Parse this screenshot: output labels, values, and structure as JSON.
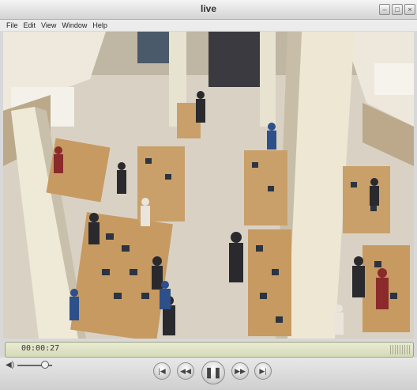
{
  "window": {
    "title": "live"
  },
  "menu": [
    "File",
    "Edit",
    "View",
    "Window",
    "Help"
  ],
  "window_buttons": {
    "minimize": "minimize-icon",
    "maximize": "maximize-icon",
    "close": "close-icon"
  },
  "player": {
    "timecode": "00:00:27",
    "video_scene": "Overhead view of a busy retail store with people browsing tablets on wooden display tables"
  },
  "controls": {
    "icons": [
      "volume-icon",
      "skip-back-icon",
      "rewind-icon",
      "pause-icon",
      "fast-forward-icon",
      "skip-forward-icon"
    ]
  },
  "colors": {
    "time_display_bg": "#dfe3c4",
    "chrome_bg": "#d8d8d8"
  }
}
